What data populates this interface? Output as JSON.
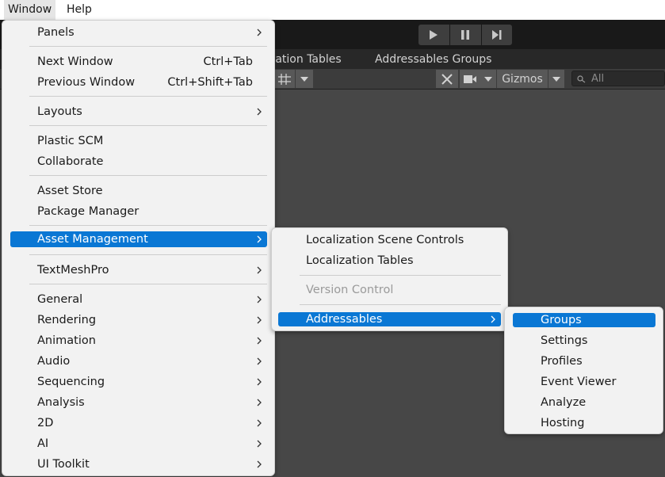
{
  "menubar": {
    "items": [
      {
        "id": "window",
        "label": "Window"
      },
      {
        "id": "help",
        "label": "Help"
      }
    ]
  },
  "tabs": [
    {
      "label": "zation Tables"
    },
    {
      "label": "Addressables Groups"
    }
  ],
  "scene_toolbar": {
    "gizmos_label": "Gizmos",
    "search_placeholder": "All"
  },
  "window_menu": {
    "items": {
      "panels": "Panels",
      "next_window": "Next Window",
      "next_window_shortcut": "Ctrl+Tab",
      "previous_window": "Previous Window",
      "previous_window_shortcut": "Ctrl+Shift+Tab",
      "layouts": "Layouts",
      "plastic_scm": "Plastic SCM",
      "collaborate": "Collaborate",
      "asset_store": "Asset Store",
      "package_manager": "Package Manager",
      "asset_management": "Asset Management",
      "textmeshpro": "TextMeshPro",
      "general": "General",
      "rendering": "Rendering",
      "animation": "Animation",
      "audio": "Audio",
      "sequencing": "Sequencing",
      "analysis": "Analysis",
      "two_d": "2D",
      "ai": "AI",
      "ui_toolkit": "UI Toolkit"
    }
  },
  "asset_management_menu": {
    "items": {
      "localization_scene_controls": "Localization Scene Controls",
      "localization_tables": "Localization Tables",
      "version_control": "Version Control",
      "addressables": "Addressables"
    }
  },
  "addressables_menu": {
    "items": {
      "groups": "Groups",
      "settings": "Settings",
      "profiles": "Profiles",
      "event_viewer": "Event Viewer",
      "analyze": "Analyze",
      "hosting": "Hosting"
    }
  },
  "icons": {
    "submenu_arrow": "chevron-right-icon",
    "play": "play-icon",
    "pause": "pause-icon",
    "step": "step-icon",
    "grid": "grid-snap-icon",
    "tools": "tools-icon",
    "camera": "camera-icon",
    "search": "search-icon"
  },
  "colors": {
    "highlight": "#0a77d4",
    "menu_bg": "#f2f2f2",
    "editor_bg": "#464646",
    "disabled_text": "#9a9a9a"
  }
}
